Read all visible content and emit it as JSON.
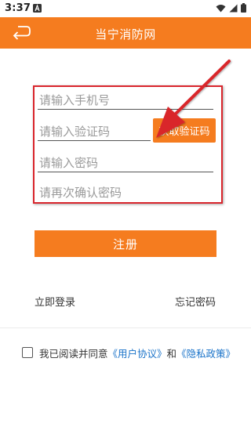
{
  "status_bar": {
    "time": "3:37"
  },
  "app_bar": {
    "title": "当宁消防网"
  },
  "form": {
    "phone_placeholder": "请输入手机号",
    "code_placeholder": "请输入验证码",
    "password_placeholder": "请输入密码",
    "confirm_placeholder": "请再次确认密码",
    "get_code_label": "获取验证码",
    "register_label": "注册"
  },
  "links": {
    "login": "立即登录",
    "forgot": "忘记密码"
  },
  "agreement": {
    "prefix": "我已阅读并同意",
    "user_agreement": "《用户协议》",
    "and": "和",
    "privacy_policy": "《隐私政策》"
  },
  "colors": {
    "accent": "#f57c1f",
    "link": "#1a73c9",
    "annotation": "#d9252c"
  }
}
